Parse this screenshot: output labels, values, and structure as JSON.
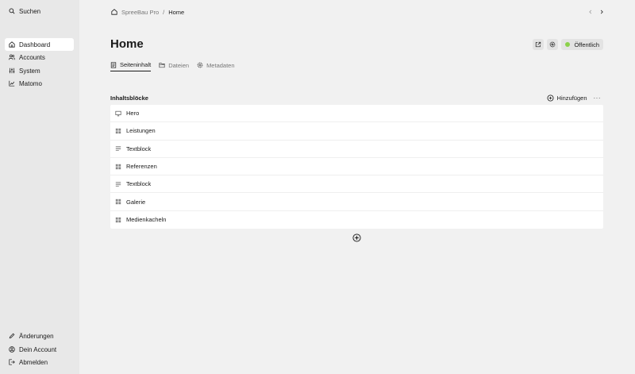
{
  "sidebar": {
    "search": {
      "label": "Suchen",
      "icon": "search-icon"
    },
    "nav": [
      {
        "label": "Dashboard",
        "icon": "home-icon",
        "active": true
      },
      {
        "label": "Accounts",
        "icon": "users-icon",
        "active": false
      },
      {
        "label": "System",
        "icon": "settings-sliders-icon",
        "active": false
      },
      {
        "label": "Matomo",
        "icon": "chart-icon",
        "active": false
      }
    ],
    "footer": [
      {
        "label": "Änderungen",
        "icon": "pencil-icon"
      },
      {
        "label": "Dein Account",
        "icon": "user-circle-icon"
      },
      {
        "label": "Abmelden",
        "icon": "logout-icon"
      }
    ]
  },
  "breadcrumb": {
    "site": "SpreeBau Pro",
    "separator": "/",
    "page": "Home"
  },
  "page": {
    "title": "Home",
    "status_label": "Öffentlich",
    "status_color": "#8bd14a"
  },
  "tabs": [
    {
      "label": "Seiteninhalt",
      "icon": "document-icon",
      "active": true
    },
    {
      "label": "Dateien",
      "icon": "folder-icon",
      "active": false
    },
    {
      "label": "Metadaten",
      "icon": "gear-icon",
      "active": false
    }
  ],
  "section": {
    "title": "Inhaltsblöcke",
    "add_label": "Hinzufügen",
    "more_label": "···"
  },
  "blocks": [
    {
      "label": "Hero",
      "icon": "monitor-icon"
    },
    {
      "label": "Leistungen",
      "icon": "grid-icon"
    },
    {
      "label": "Textblock",
      "icon": "text-lines-icon"
    },
    {
      "label": "Referenzen",
      "icon": "grid-icon"
    },
    {
      "label": "Textblock",
      "icon": "text-lines-icon"
    },
    {
      "label": "Galerie",
      "icon": "grid-icon"
    },
    {
      "label": "Medienkacheln",
      "icon": "grid-icon"
    }
  ]
}
